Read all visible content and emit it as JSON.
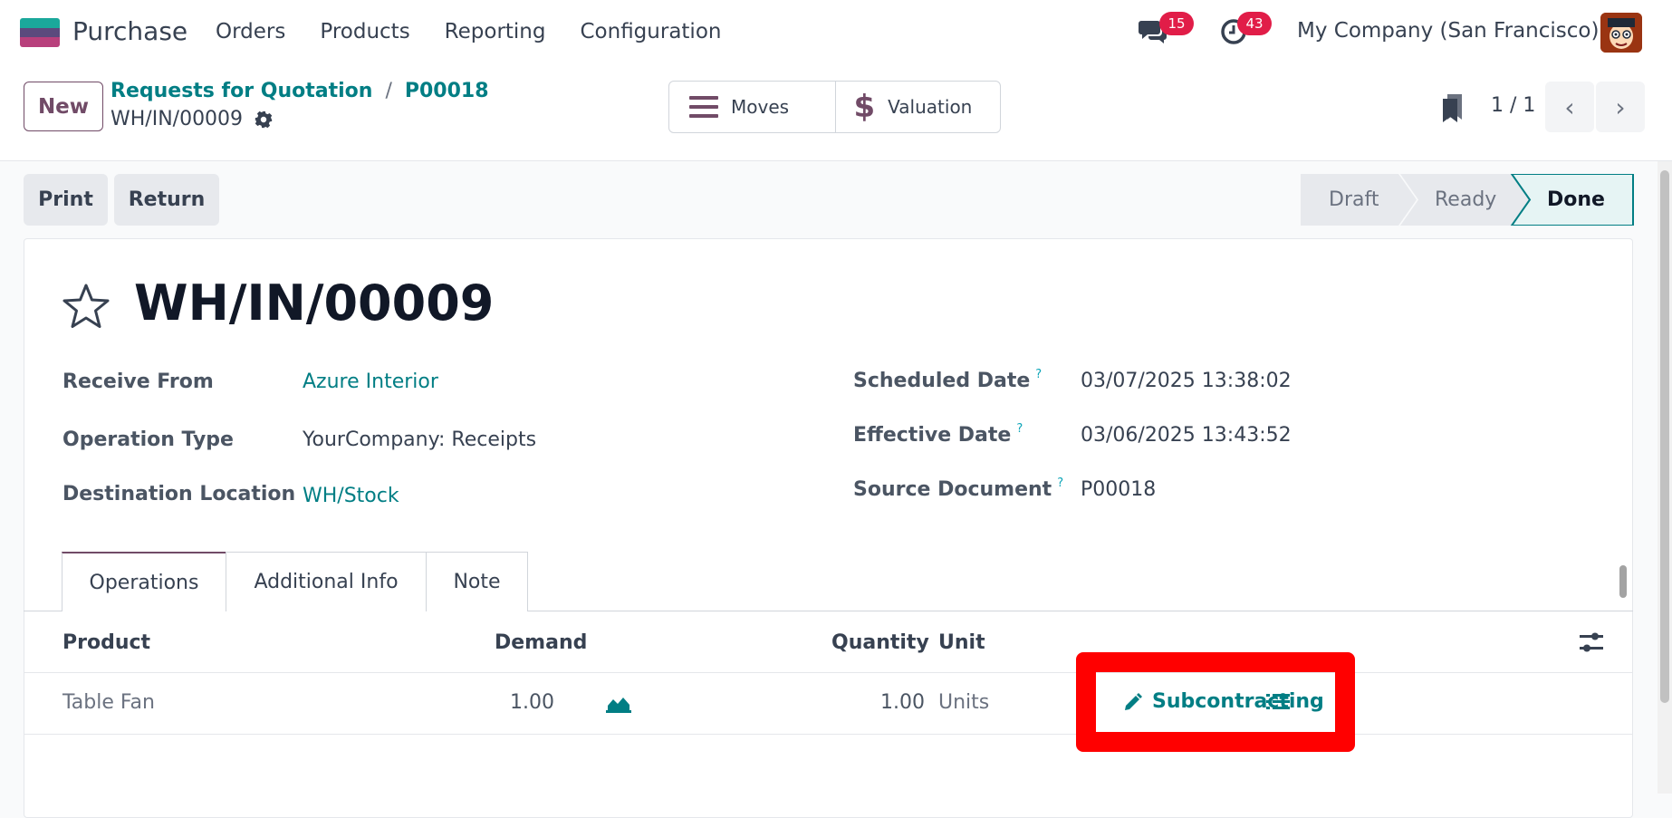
{
  "navbar": {
    "app_name": "Purchase",
    "menu": [
      "Orders",
      "Products",
      "Reporting",
      "Configuration"
    ],
    "messages_count": "15",
    "activities_count": "43",
    "company": "My Company (San Francisco)"
  },
  "control_panel": {
    "new_label": "New",
    "breadcrumb": [
      "Requests for Quotation",
      "P00018"
    ],
    "breadcrumb_sep": "/",
    "record_name": "WH/IN/00009",
    "smart_buttons": {
      "moves": "Moves",
      "valuation": "Valuation"
    },
    "pager": "1 / 1"
  },
  "status": {
    "print_label": "Print",
    "return_label": "Return",
    "stages": [
      "Draft",
      "Ready",
      "Done"
    ],
    "active_stage": "Done"
  },
  "form": {
    "title": "WH/IN/00009",
    "left_fields": [
      {
        "label": "Receive From",
        "value": "Azure Interior"
      },
      {
        "label": "Operation Type",
        "value": "YourCompany: Receipts"
      },
      {
        "label": "Destination Location",
        "value": "WH/Stock"
      }
    ],
    "right_fields": [
      {
        "label": "Scheduled Date",
        "value": "03/07/2025 13:38:02"
      },
      {
        "label": "Effective Date",
        "value": "03/06/2025 13:43:52"
      },
      {
        "label": "Source Document",
        "value": "P00018"
      }
    ],
    "help_mark": "?"
  },
  "tabs": [
    "Operations",
    "Additional Info",
    "Note"
  ],
  "table": {
    "columns": [
      "Product",
      "Demand",
      "Quantity",
      "Unit"
    ],
    "rows": [
      {
        "product": "Table Fan",
        "demand": "1.00",
        "quantity": "1.00",
        "unit": "Units",
        "action": "Subcontracting"
      }
    ]
  },
  "colors": {
    "brand": "#714b67",
    "link": "#017e84",
    "badge": "#e11d48",
    "highlight": "#ff0000"
  }
}
